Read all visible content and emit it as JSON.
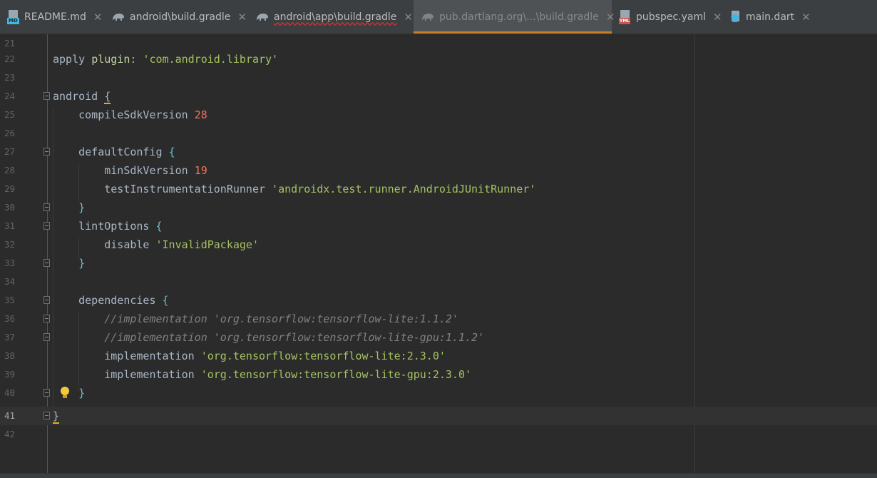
{
  "tabs": [
    {
      "label": "README.md",
      "icon": "markdown-file-icon",
      "close": "✕"
    },
    {
      "label": "android\\build.gradle",
      "icon": "gradle-elephant-icon",
      "close": "✕"
    },
    {
      "label": "android\\app\\build.gradle",
      "icon": "gradle-elephant-icon",
      "close": "✕"
    },
    {
      "label": "pub.dartlang.org\\...\\build.gradle",
      "icon": "gradle-elephant-icon",
      "close": "✕"
    },
    {
      "label": "pubspec.yaml",
      "icon": "yaml-file-icon",
      "close": "✕"
    },
    {
      "label": "main.dart",
      "icon": "dart-file-icon",
      "close": "✕"
    }
  ],
  "icons": {
    "md_badge": "MD",
    "yml_badge": "YML"
  },
  "colors": {
    "active_tab_underline": "#c87f25",
    "keyword": "#cc7832",
    "string": "#a5c261",
    "number": "#f0725f",
    "comment": "#808080"
  },
  "editor": {
    "lines": [
      {
        "n": "21"
      },
      {
        "n": "22",
        "t1": "apply ",
        "t2": "plugin",
        "t3": ": ",
        "t4": "'com.android.library'"
      },
      {
        "n": "23"
      },
      {
        "n": "24",
        "t1": "android ",
        "t2": "{"
      },
      {
        "n": "25",
        "t1": "    compileSdkVersion ",
        "t2": "28"
      },
      {
        "n": "26"
      },
      {
        "n": "27",
        "t1": "    defaultConfig ",
        "t2": "{"
      },
      {
        "n": "28",
        "t1": "        minSdkVersion ",
        "t2": "19"
      },
      {
        "n": "29",
        "t1": "        testInstrumentationRunner ",
        "t2": "'androidx.test.runner.AndroidJUnitRunner'"
      },
      {
        "n": "30",
        "t1": "    }"
      },
      {
        "n": "31",
        "t1": "    lintOptions ",
        "t2": "{"
      },
      {
        "n": "32",
        "t1": "        disable ",
        "t2": "'InvalidPackage'"
      },
      {
        "n": "33",
        "t1": "    }"
      },
      {
        "n": "34"
      },
      {
        "n": "35",
        "t1": "    dependencies ",
        "t2": "{"
      },
      {
        "n": "36",
        "t1": "        //implementation 'org.tensorflow:tensorflow-lite:1.1.2'"
      },
      {
        "n": "37",
        "t1": "        //implementation 'org.tensorflow:tensorflow-lite-gpu:1.1.2'"
      },
      {
        "n": "38",
        "t1": "        implementation ",
        "t2": "'org.tensorflow:tensorflow-lite:2.3.0'"
      },
      {
        "n": "39",
        "t1": "        implementation ",
        "t2": "'org.tensorflow:tensorflow-lite-gpu:2.3.0'"
      },
      {
        "n": "40",
        "t1": "    }"
      },
      {
        "n": "41",
        "t1": "}"
      },
      {
        "n": "42"
      }
    ]
  }
}
